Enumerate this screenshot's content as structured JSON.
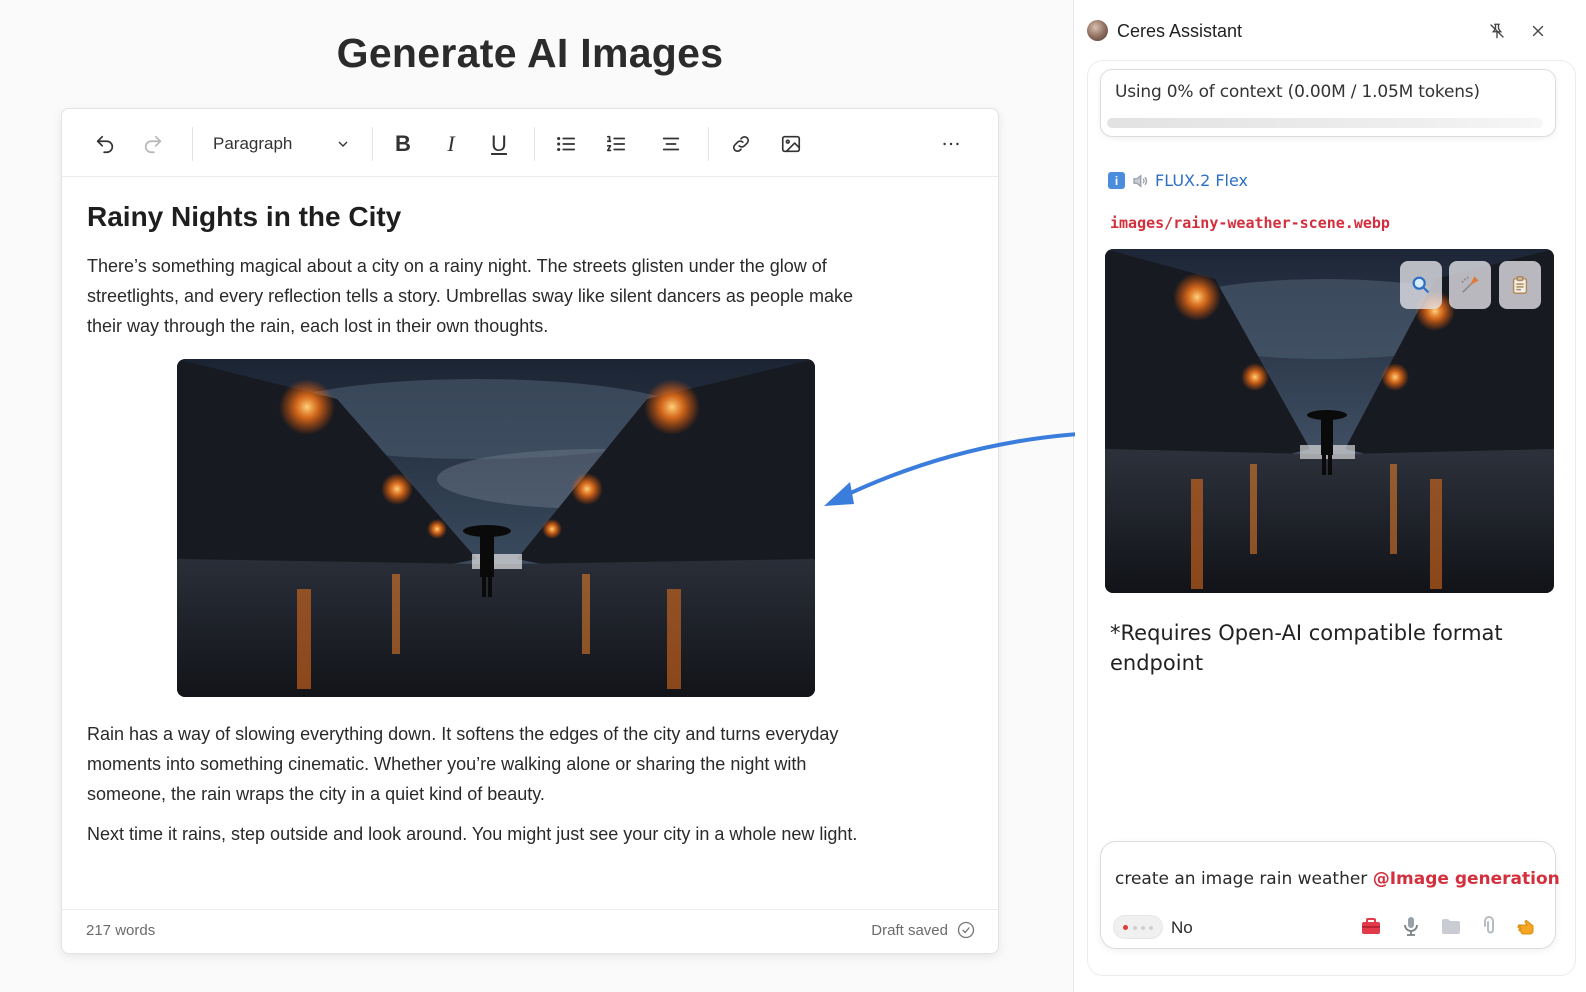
{
  "page": {
    "title": "Generate AI Images"
  },
  "editor": {
    "toolbar": {
      "block_type": "Paragraph",
      "bold_label": "B",
      "italic_label": "I",
      "underline_label": "U"
    },
    "document": {
      "heading": "Rainy Nights in the City",
      "paragraphs": [
        "There’s something magical about a city on a rainy night. The streets glisten under the glow of streetlights, and every reflection tells a story. Umbrellas sway like silent dancers as people make their way through the rain, each lost in their own thoughts.",
        "Rain has a way of slowing everything down. It softens the edges of the city and turns everyday moments into something cinematic. Whether you’re walking alone or sharing the night with someone, the rain wraps the city in a quiet kind of beauty.",
        "Next time it rains, step outside and look around. You might just see your city in a whole new light."
      ]
    },
    "footer": {
      "word_count": "217 words",
      "status": "Draft saved"
    }
  },
  "assistant": {
    "title": "Ceres Assistant",
    "context": {
      "text": "Using 0% of context (0.00M / 1.05M tokens)",
      "percent": 0
    },
    "model": {
      "info_badge": "i",
      "name": "FLUX.2 Flex"
    },
    "file_path": "images/rainy-weather-scene.webp",
    "note": "*Requires Open-AI compatible format endpoint",
    "input": {
      "text": "create an image rain weather ",
      "mention": "@Image generation",
      "toggle_label": "No"
    }
  },
  "colors": {
    "accent_blue": "#2c6fc4",
    "arrow_blue": "#3b7ddd",
    "mention_red": "#d32f3c"
  },
  "icons": [
    "undo-icon",
    "redo-icon",
    "chevron-down-icon",
    "bold-icon",
    "italic-icon",
    "underline-icon",
    "bullet-list-icon",
    "numbered-list-icon",
    "align-center-icon",
    "link-icon",
    "image-icon",
    "more-icon",
    "check-circle-icon",
    "pin-icon",
    "close-icon",
    "search-icon",
    "edit-image-icon",
    "clipboard-icon",
    "toolbox-icon",
    "microphone-icon",
    "folder-icon",
    "paperclip-icon",
    "pointing-hand-icon"
  ]
}
